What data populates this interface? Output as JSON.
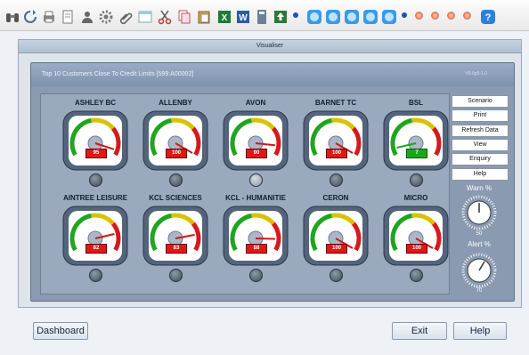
{
  "window": {
    "title": "Visualiser"
  },
  "panel": {
    "title": "Top 10 Customers Close To Credit Limits [599:A00002]",
    "version": "V8.0p5-1.0"
  },
  "gauges": [
    {
      "name": "ASHLEY BC",
      "value": "95",
      "level": 95,
      "color": "red"
    },
    {
      "name": "ALLENBY",
      "value": "100",
      "level": 100,
      "color": "red"
    },
    {
      "name": "AVON",
      "value": "90",
      "level": 90,
      "color": "red"
    },
    {
      "name": "BARNET TC",
      "value": "100",
      "level": 100,
      "color": "red"
    },
    {
      "name": "BSL",
      "value": "7",
      "level": 7,
      "color": "green"
    },
    {
      "name": "AINTREE LEISURE",
      "value": "82",
      "level": 82,
      "color": "red"
    },
    {
      "name": "KCL SCIENCES",
      "value": "83",
      "level": 83,
      "color": "red"
    },
    {
      "name": "KCL - HUMANITIE",
      "value": "88",
      "level": 88,
      "color": "red"
    },
    {
      "name": "CERON",
      "value": "100",
      "level": 100,
      "color": "red"
    },
    {
      "name": "MICRO",
      "value": "100",
      "level": 100,
      "color": "red"
    }
  ],
  "side_buttons": [
    "Scenario",
    "Print",
    "Refresh Data",
    "View",
    "Enquiry",
    "Help"
  ],
  "warn": {
    "label": "Warn %",
    "value": "50"
  },
  "alert": {
    "label": "Alert %",
    "value": "70"
  },
  "bottom": {
    "dashboard": "Dashboard",
    "exit": "Exit",
    "help": "Help"
  }
}
